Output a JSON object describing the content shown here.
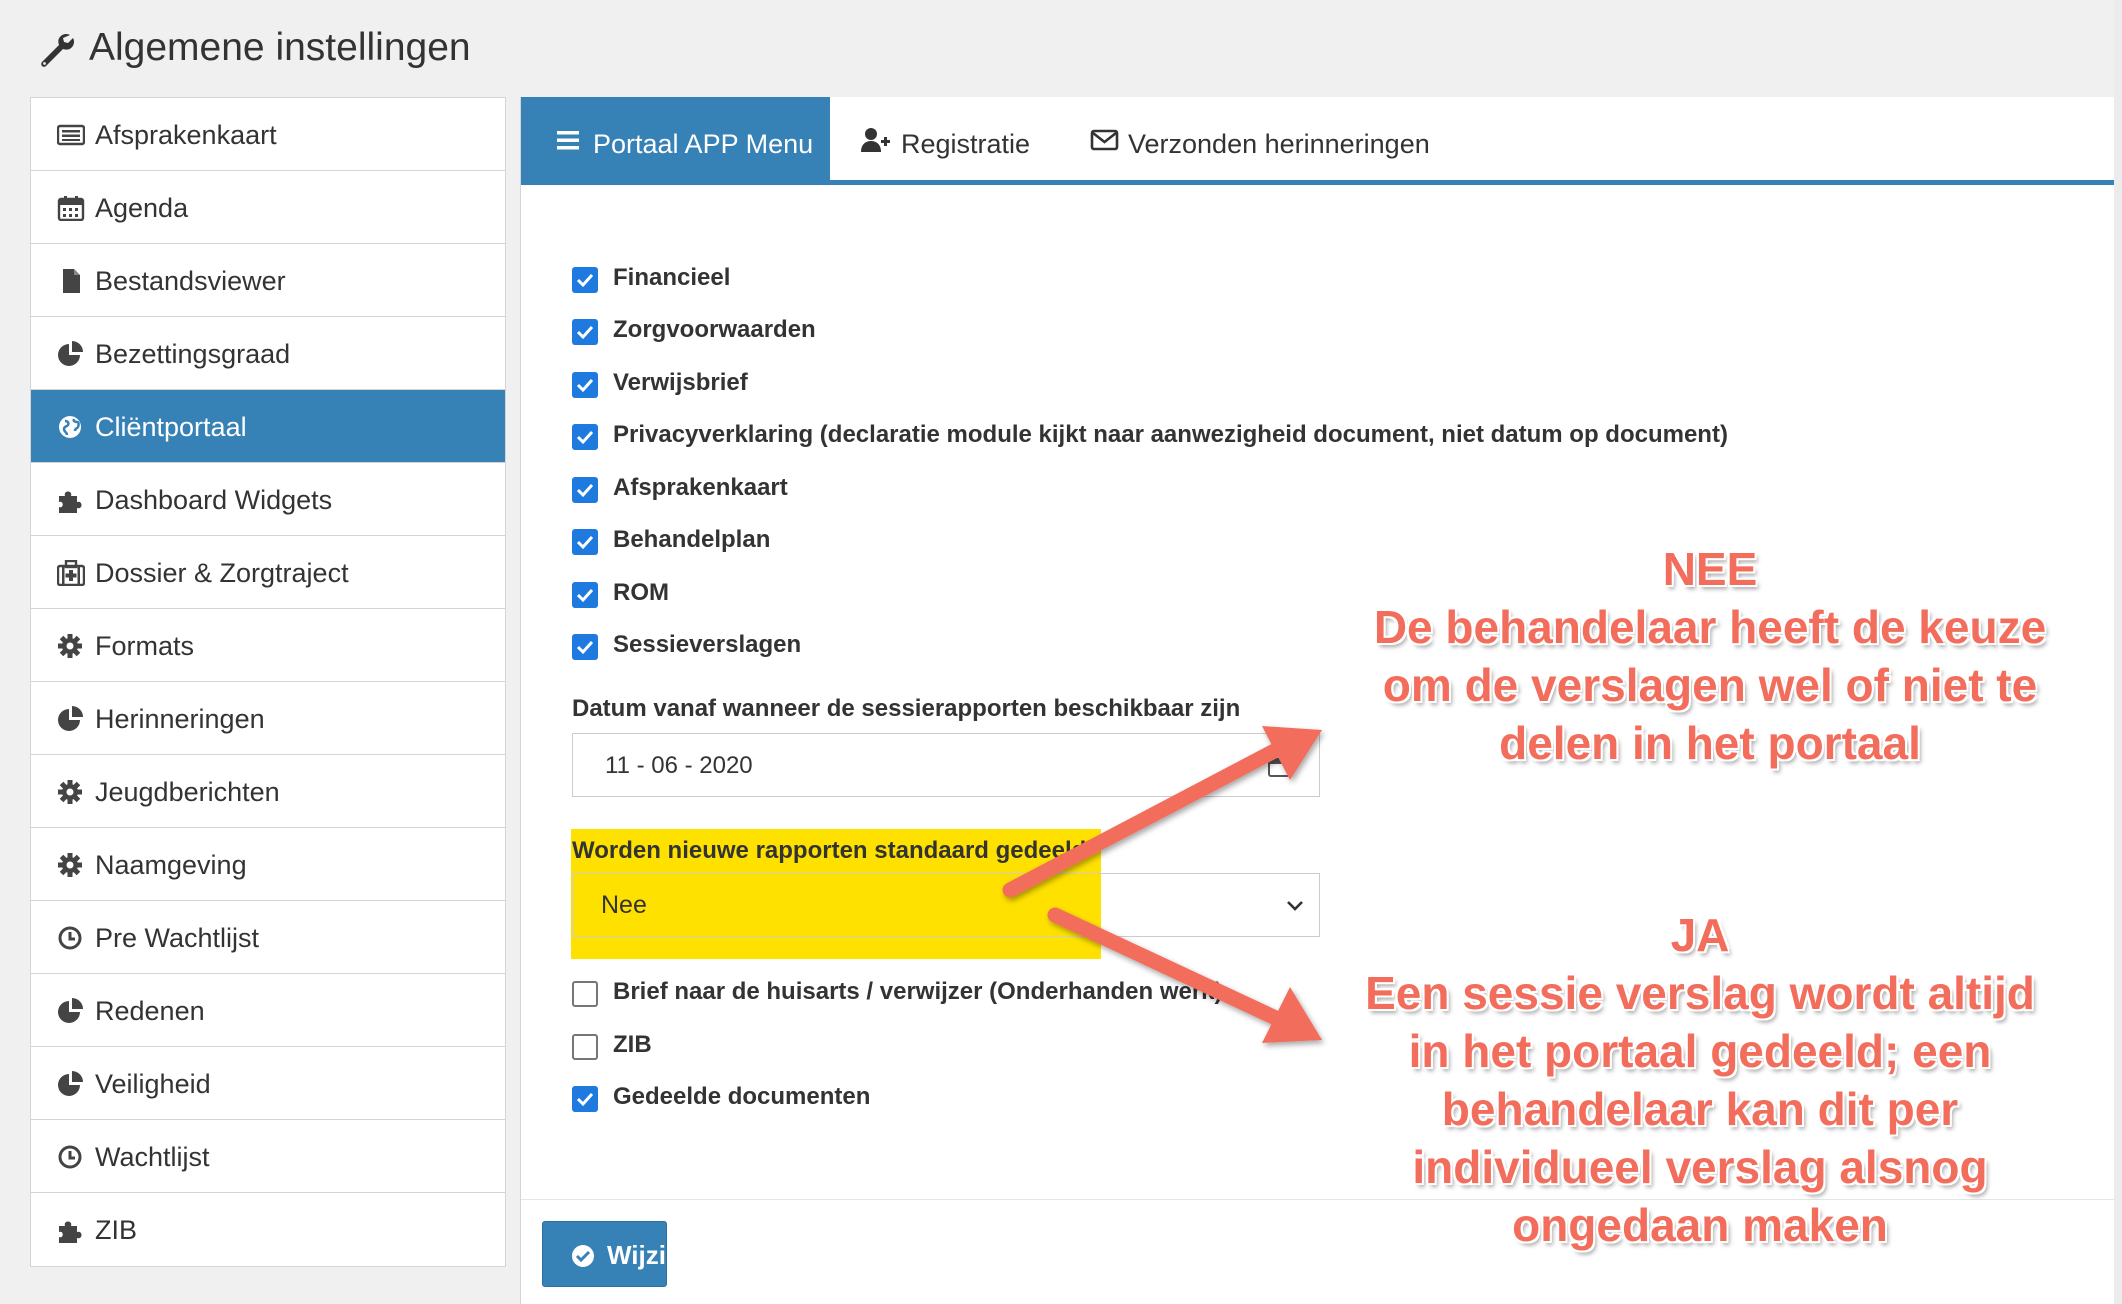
{
  "header": {
    "title": "Algemene instellingen",
    "icon": "wrench-icon"
  },
  "sidebar": {
    "items": [
      {
        "label": "Afsprakenkaart",
        "icon": "list-card-icon",
        "active": false
      },
      {
        "label": "Agenda",
        "icon": "calendar-icon",
        "active": false
      },
      {
        "label": "Bestandsviewer",
        "icon": "file-icon",
        "active": false
      },
      {
        "label": "Bezettingsgraad",
        "icon": "pie-chart-icon",
        "active": false
      },
      {
        "label": "Cliëntportaal",
        "icon": "globe-icon",
        "active": true
      },
      {
        "label": "Dashboard Widgets",
        "icon": "puzzle-icon",
        "active": false
      },
      {
        "label": "Dossier & Zorgtraject",
        "icon": "medkit-icon",
        "active": false
      },
      {
        "label": "Formats",
        "icon": "gear-icon",
        "active": false
      },
      {
        "label": "Herinneringen",
        "icon": "pie-chart-icon",
        "active": false
      },
      {
        "label": "Jeugdberichten",
        "icon": "gear-icon",
        "active": false
      },
      {
        "label": "Naamgeving",
        "icon": "gear-icon",
        "active": false
      },
      {
        "label": "Pre Wachtlijst",
        "icon": "clock-icon",
        "active": false
      },
      {
        "label": "Redenen",
        "icon": "pie-chart-icon",
        "active": false
      },
      {
        "label": "Veiligheid",
        "icon": "pie-chart-icon",
        "active": false
      },
      {
        "label": "Wachtlijst",
        "icon": "clock-icon",
        "active": false
      },
      {
        "label": "ZIB",
        "icon": "puzzle-icon",
        "active": false
      }
    ]
  },
  "tabs": [
    {
      "label": "Portaal APP Menu",
      "icon": "bars-icon",
      "active": true
    },
    {
      "label": "Registratie",
      "icon": "user-plus-icon",
      "active": false
    },
    {
      "label": "Verzonden herinneringen",
      "icon": "envelope-icon",
      "active": false
    }
  ],
  "checkboxes": [
    {
      "label": "Financieel",
      "checked": true
    },
    {
      "label": "Zorgvoorwaarden",
      "checked": true
    },
    {
      "label": "Verwijsbrief",
      "checked": true
    },
    {
      "label": "Privacyverklaring (declaratie module kijkt naar aanwezigheid document, niet datum op document)",
      "checked": true
    },
    {
      "label": "Afsprakenkaart",
      "checked": true
    },
    {
      "label": "Behandelplan",
      "checked": true
    },
    {
      "label": "ROM",
      "checked": true
    },
    {
      "label": "Sessieverslagen",
      "checked": true
    }
  ],
  "date_field": {
    "label": "Datum vanaf wanneer de sessierapporten beschikbaar zijn",
    "value": "11 - 06 - 2020"
  },
  "share_field": {
    "label": "Worden nieuwe rapporten standaard gedeeld",
    "value": "Nee"
  },
  "checkboxes_bottom": [
    {
      "label": "Brief naar de huisarts / verwijzer (Onderhanden werk)",
      "checked": false
    },
    {
      "label": "ZIB",
      "checked": false
    },
    {
      "label": "Gedeelde documenten",
      "checked": true
    }
  ],
  "save_button": {
    "label": "Wijzig",
    "icon": "check-circle-icon"
  },
  "annotations": {
    "nee": {
      "lines": [
        "NEE",
        "De behandelaar heeft de keuze",
        "om de verslagen wel of niet te",
        "delen in het portaal"
      ]
    },
    "ja": {
      "lines": [
        "JA",
        "Een sessie verslag wordt altijd",
        "in het portaal gedeeld; een",
        "behandelaar kan dit per",
        "individueel verslag alsnog",
        "ongedaan maken"
      ]
    }
  },
  "colors": {
    "primary": "#3681b6",
    "checkbox": "#1f7ae0",
    "highlight": "#ffe100",
    "annotation": "#f26d5b"
  }
}
